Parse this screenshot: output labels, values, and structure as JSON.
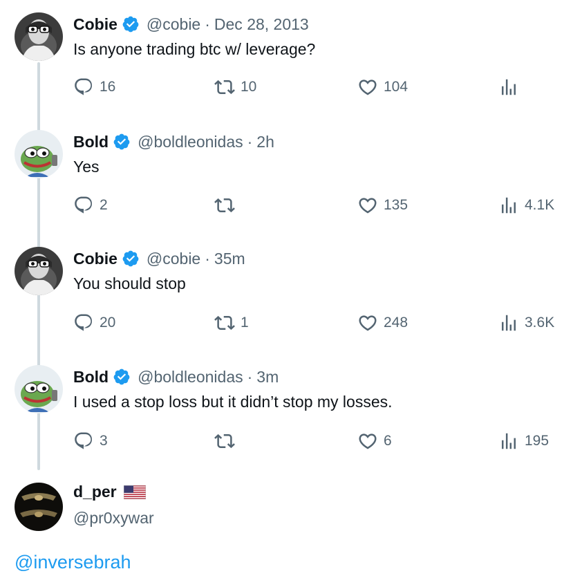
{
  "tweets": [
    {
      "name": "Cobie",
      "handle": "@cobie",
      "time": "Dec 28, 2013",
      "text": "Is anyone trading btc w/ leverage?",
      "replies": "16",
      "retweets": "10",
      "likes": "104",
      "views": ""
    },
    {
      "name": "Bold",
      "handle": "@boldleonidas",
      "time": "2h",
      "text": "Yes",
      "replies": "2",
      "retweets": "",
      "likes": "135",
      "views": "4.1K"
    },
    {
      "name": "Cobie",
      "handle": "@cobie",
      "time": "35m",
      "text": "You should stop",
      "replies": "20",
      "retweets": "1",
      "likes": "248",
      "views": "3.6K"
    },
    {
      "name": "Bold",
      "handle": "@boldleonidas",
      "time": "3m",
      "text": "I used a stop loss but it didn’t stop my losses.",
      "replies": "3",
      "retweets": "",
      "likes": "6",
      "views": "195"
    }
  ],
  "reply_author": {
    "name": "d_per",
    "handle": "@pr0xywar",
    "flag": "us-flag-icon"
  },
  "reply_text": "@inversebrah",
  "separator": "·",
  "colors": {
    "verified": "#1d9bf0",
    "muted": "#536471",
    "link": "#1d9bf0",
    "thread_line": "#cfd9de"
  }
}
